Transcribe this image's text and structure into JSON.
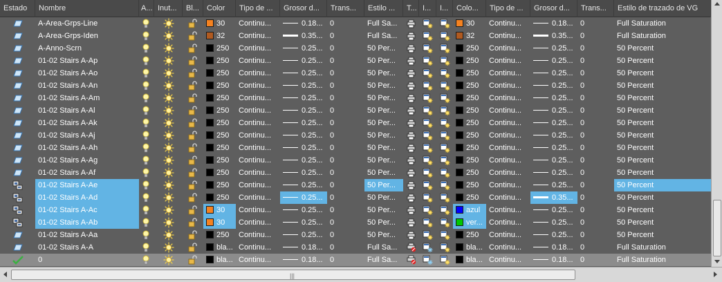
{
  "columns": [
    {
      "key": "estado",
      "label": "Estado"
    },
    {
      "key": "nombre",
      "label": "Nombre"
    },
    {
      "key": "activado",
      "label": "A..."
    },
    {
      "key": "inutilizar",
      "label": "Inut..."
    },
    {
      "key": "bloquear",
      "label": "Bl..."
    },
    {
      "key": "color",
      "label": "Color"
    },
    {
      "key": "tipolinea",
      "label": "Tipo de ..."
    },
    {
      "key": "grosor",
      "label": "Grosor d..."
    },
    {
      "key": "transp",
      "label": "Trans..."
    },
    {
      "key": "estilo",
      "label": "Estilo ..."
    },
    {
      "key": "trazar",
      "label": "T..."
    },
    {
      "key": "ivp1",
      "label": "I..."
    },
    {
      "key": "ivp2",
      "label": "I..."
    },
    {
      "key": "colorvg",
      "label": "Colo..."
    },
    {
      "key": "tipovg",
      "label": "Tipo de ..."
    },
    {
      "key": "grosorvg",
      "label": "Grosor d..."
    },
    {
      "key": "transvg",
      "label": "Trans..."
    },
    {
      "key": "estilovg",
      "label": "Estilo de trazado de VG"
    }
  ],
  "colors": {
    "orange": "#f58220",
    "brown": "#b05a20",
    "black": "#000000",
    "blue": "#0000ff",
    "green": "#00c800",
    "selection": "#62b4e4",
    "current_row": "#8c8c8c"
  },
  "rows": [
    {
      "status": "layer-icon",
      "name": "A-Area-Grps-Line",
      "color": "30",
      "swatch": "#f58220",
      "ltype": "Continu...",
      "lweight": "0.18...",
      "thick": false,
      "transp": "0",
      "style": "Full Sa...",
      "vgcolor": "30",
      "vgswatch": "#f58220",
      "vgltype": "Continu...",
      "vglweight": "0.18...",
      "vgthick": false,
      "vgtransp": "0",
      "vgstyle": "Full Saturation",
      "sel": []
    },
    {
      "status": "layer-icon",
      "name": "A-Area-Grps-Iden",
      "color": "32",
      "swatch": "#b05a20",
      "ltype": "Continu...",
      "lweight": "0.35...",
      "thick": true,
      "transp": "0",
      "style": "Full Sa...",
      "vgcolor": "32",
      "vgswatch": "#b05a20",
      "vgltype": "Continu...",
      "vglweight": "0.35...",
      "vgthick": true,
      "vgtransp": "0",
      "vgstyle": "Full Saturation",
      "sel": []
    },
    {
      "status": "layer-icon",
      "name": "A-Anno-Scrn",
      "color": "250",
      "swatch": "#000000",
      "ltype": "Continu...",
      "lweight": "0.25...",
      "thick": false,
      "transp": "0",
      "style": "50 Per...",
      "vgcolor": "250",
      "vgswatch": "#000000",
      "vgltype": "Continu...",
      "vglweight": "0.25...",
      "vgthick": false,
      "vgtransp": "0",
      "vgstyle": "50 Percent",
      "sel": []
    },
    {
      "status": "layer-icon",
      "name": "01-02 Stairs A-Ap",
      "color": "250",
      "swatch": "#000000",
      "ltype": "Continu...",
      "lweight": "0.25...",
      "thick": false,
      "transp": "0",
      "style": "50 Per...",
      "vgcolor": "250",
      "vgswatch": "#000000",
      "vgltype": "Continu...",
      "vglweight": "0.25...",
      "vgthick": false,
      "vgtransp": "0",
      "vgstyle": "50 Percent",
      "sel": []
    },
    {
      "status": "layer-icon",
      "name": "01-02 Stairs A-Ao",
      "color": "250",
      "swatch": "#000000",
      "ltype": "Continu...",
      "lweight": "0.25...",
      "thick": false,
      "transp": "0",
      "style": "50 Per...",
      "vgcolor": "250",
      "vgswatch": "#000000",
      "vgltype": "Continu...",
      "vglweight": "0.25...",
      "vgthick": false,
      "vgtransp": "0",
      "vgstyle": "50 Percent",
      "sel": []
    },
    {
      "status": "layer-icon",
      "name": "01-02 Stairs A-An",
      "color": "250",
      "swatch": "#000000",
      "ltype": "Continu...",
      "lweight": "0.25...",
      "thick": false,
      "transp": "0",
      "style": "50 Per...",
      "vgcolor": "250",
      "vgswatch": "#000000",
      "vgltype": "Continu...",
      "vglweight": "0.25...",
      "vgthick": false,
      "vgtransp": "0",
      "vgstyle": "50 Percent",
      "sel": []
    },
    {
      "status": "layer-icon",
      "name": "01-02 Stairs A-Am",
      "color": "250",
      "swatch": "#000000",
      "ltype": "Continu...",
      "lweight": "0.25...",
      "thick": false,
      "transp": "0",
      "style": "50 Per...",
      "vgcolor": "250",
      "vgswatch": "#000000",
      "vgltype": "Continu...",
      "vglweight": "0.25...",
      "vgthick": false,
      "vgtransp": "0",
      "vgstyle": "50 Percent",
      "sel": []
    },
    {
      "status": "layer-icon",
      "name": "01-02 Stairs A-Al",
      "color": "250",
      "swatch": "#000000",
      "ltype": "Continu...",
      "lweight": "0.25...",
      "thick": false,
      "transp": "0",
      "style": "50 Per...",
      "vgcolor": "250",
      "vgswatch": "#000000",
      "vgltype": "Continu...",
      "vglweight": "0.25...",
      "vgthick": false,
      "vgtransp": "0",
      "vgstyle": "50 Percent",
      "sel": []
    },
    {
      "status": "layer-icon",
      "name": "01-02 Stairs A-Ak",
      "color": "250",
      "swatch": "#000000",
      "ltype": "Continu...",
      "lweight": "0.25...",
      "thick": false,
      "transp": "0",
      "style": "50 Per...",
      "vgcolor": "250",
      "vgswatch": "#000000",
      "vgltype": "Continu...",
      "vglweight": "0.25...",
      "vgthick": false,
      "vgtransp": "0",
      "vgstyle": "50 Percent",
      "sel": []
    },
    {
      "status": "layer-icon",
      "name": "01-02 Stairs A-Aj",
      "color": "250",
      "swatch": "#000000",
      "ltype": "Continu...",
      "lweight": "0.25...",
      "thick": false,
      "transp": "0",
      "style": "50 Per...",
      "vgcolor": "250",
      "vgswatch": "#000000",
      "vgltype": "Continu...",
      "vglweight": "0.25...",
      "vgthick": false,
      "vgtransp": "0",
      "vgstyle": "50 Percent",
      "sel": []
    },
    {
      "status": "layer-icon",
      "name": "01-02 Stairs A-Ah",
      "color": "250",
      "swatch": "#000000",
      "ltype": "Continu...",
      "lweight": "0.25...",
      "thick": false,
      "transp": "0",
      "style": "50 Per...",
      "vgcolor": "250",
      "vgswatch": "#000000",
      "vgltype": "Continu...",
      "vglweight": "0.25...",
      "vgthick": false,
      "vgtransp": "0",
      "vgstyle": "50 Percent",
      "sel": []
    },
    {
      "status": "layer-icon",
      "name": "01-02 Stairs A-Ag",
      "color": "250",
      "swatch": "#000000",
      "ltype": "Continu...",
      "lweight": "0.25...",
      "thick": false,
      "transp": "0",
      "style": "50 Per...",
      "vgcolor": "250",
      "vgswatch": "#000000",
      "vgltype": "Continu...",
      "vglweight": "0.25...",
      "vgthick": false,
      "vgtransp": "0",
      "vgstyle": "50 Percent",
      "sel": []
    },
    {
      "status": "layer-icon",
      "name": "01-02 Stairs A-Af",
      "color": "250",
      "swatch": "#000000",
      "ltype": "Continu...",
      "lweight": "0.25...",
      "thick": false,
      "transp": "0",
      "style": "50 Per...",
      "vgcolor": "250",
      "vgswatch": "#000000",
      "vgltype": "Continu...",
      "vglweight": "0.25...",
      "vgthick": false,
      "vgtransp": "0",
      "vgstyle": "50 Percent",
      "sel": []
    },
    {
      "status": "layer-state-icon",
      "name": "01-02 Stairs A-Ae",
      "color": "250",
      "swatch": "#000000",
      "ltype": "Continu...",
      "lweight": "0.25...",
      "thick": false,
      "transp": "0",
      "style": "50 Per...",
      "vgcolor": "250",
      "vgswatch": "#000000",
      "vgltype": "Continu...",
      "vglweight": "0.25...",
      "vgthick": false,
      "vgtransp": "0",
      "vgstyle": "50 Percent",
      "sel": [
        "name",
        "style",
        "vgstyle"
      ]
    },
    {
      "status": "layer-state-icon",
      "name": "01-02 Stairs A-Ad",
      "color": "250",
      "swatch": "#000000",
      "ltype": "Continu...",
      "lweight": "0.25...",
      "thick": false,
      "transp": "0",
      "style": "50 Per...",
      "vgcolor": "250",
      "vgswatch": "#000000",
      "vgltype": "Continu...",
      "vglweight": "0.35...",
      "vgthick": true,
      "vgtransp": "0",
      "vgstyle": "50 Percent",
      "sel": [
        "name",
        "lweight",
        "vglweight"
      ]
    },
    {
      "status": "layer-state-icon",
      "name": "01-02 Stairs A-Ac",
      "color": "30",
      "swatch": "#f58220",
      "ltype": "Continu...",
      "lweight": "0.25...",
      "thick": false,
      "transp": "0",
      "style": "50 Per...",
      "vgcolor": "azul",
      "vgswatch": "#0000ff",
      "vgltype": "Continu...",
      "vglweight": "0.25...",
      "vgthick": false,
      "vgtransp": "0",
      "vgstyle": "50 Percent",
      "sel": [
        "name",
        "color",
        "vgcolor"
      ]
    },
    {
      "status": "layer-state-icon",
      "name": "01-02 Stairs A-Ab",
      "color": "30",
      "swatch": "#f58220",
      "ltype": "Continu...",
      "lweight": "0.25...",
      "thick": false,
      "transp": "0",
      "style": "50 Per...",
      "vgcolor": "ver...",
      "vgswatch": "#00c800",
      "vgltype": "Continu...",
      "vglweight": "0.25...",
      "vgthick": false,
      "vgtransp": "0",
      "vgstyle": "50 Percent",
      "sel": [
        "name",
        "color",
        "vgcolor"
      ]
    },
    {
      "status": "layer-icon",
      "name": "01-02 Stairs A-Aa",
      "color": "250",
      "swatch": "#000000",
      "ltype": "Continu...",
      "lweight": "0.25...",
      "thick": false,
      "transp": "0",
      "style": "50 Per...",
      "vgcolor": "250",
      "vgswatch": "#000000",
      "vgltype": "Continu...",
      "vglweight": "0.25...",
      "vgthick": false,
      "vgtransp": "0",
      "vgstyle": "50 Percent",
      "sel": []
    },
    {
      "status": "layer-icon",
      "name": "01-02 Stairs A-A",
      "color": "bla...",
      "swatch": "#000000",
      "ltype": "Continu...",
      "lweight": "0.18...",
      "thick": false,
      "transp": "0",
      "style": "Full Sa...",
      "noplot": true,
      "vgcolor": "bla...",
      "vgswatch": "#000000",
      "vgltype": "Continu...",
      "vglweight": "0.18...",
      "vgthick": false,
      "vgtransp": "0",
      "vgstyle": "Full Saturation",
      "sel": []
    },
    {
      "status": "current-layer-check-icon",
      "name": "0",
      "color": "bla...",
      "swatch": "#000000",
      "ltype": "Continu...",
      "lweight": "0.18...",
      "thick": false,
      "transp": "0",
      "style": "Full Sa...",
      "noplot": true,
      "current": true,
      "vgcolor": "bla...",
      "vgswatch": "#000000",
      "vgltype": "Continu...",
      "vglweight": "0.18...",
      "vgthick": false,
      "vgtransp": "0",
      "vgstyle": "Full Saturation",
      "sel": []
    }
  ],
  "hscroll_grip": "|||",
  "vscroll_up": "scroll-up-arrow-icon",
  "vscroll_down": "scroll-down-arrow-icon"
}
